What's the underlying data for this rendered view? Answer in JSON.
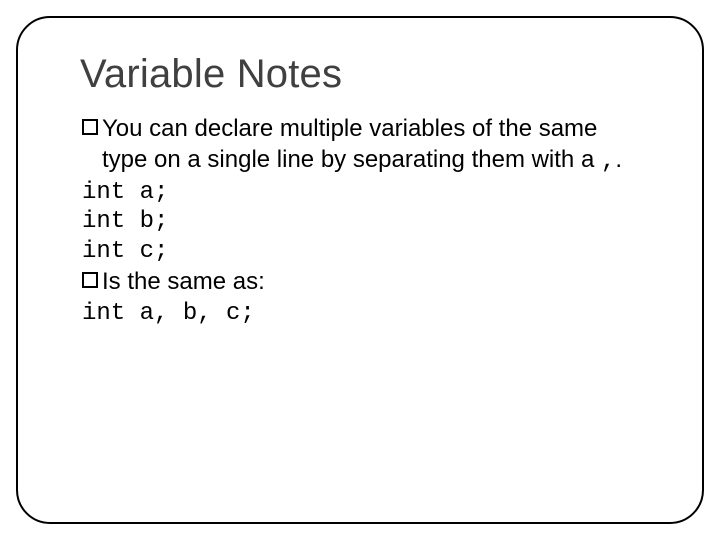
{
  "slide": {
    "title": "Variable Notes",
    "bullet1_part1": "You can declare multiple variables of the same",
    "bullet1_cont": "type on a single line by separating them with a",
    "comma_symbol": ",",
    "period": ".",
    "code1": "int a;",
    "code2": "int b;",
    "code3": "int c;",
    "bullet2": "Is the same as:",
    "code4": "int a, b, c;"
  }
}
